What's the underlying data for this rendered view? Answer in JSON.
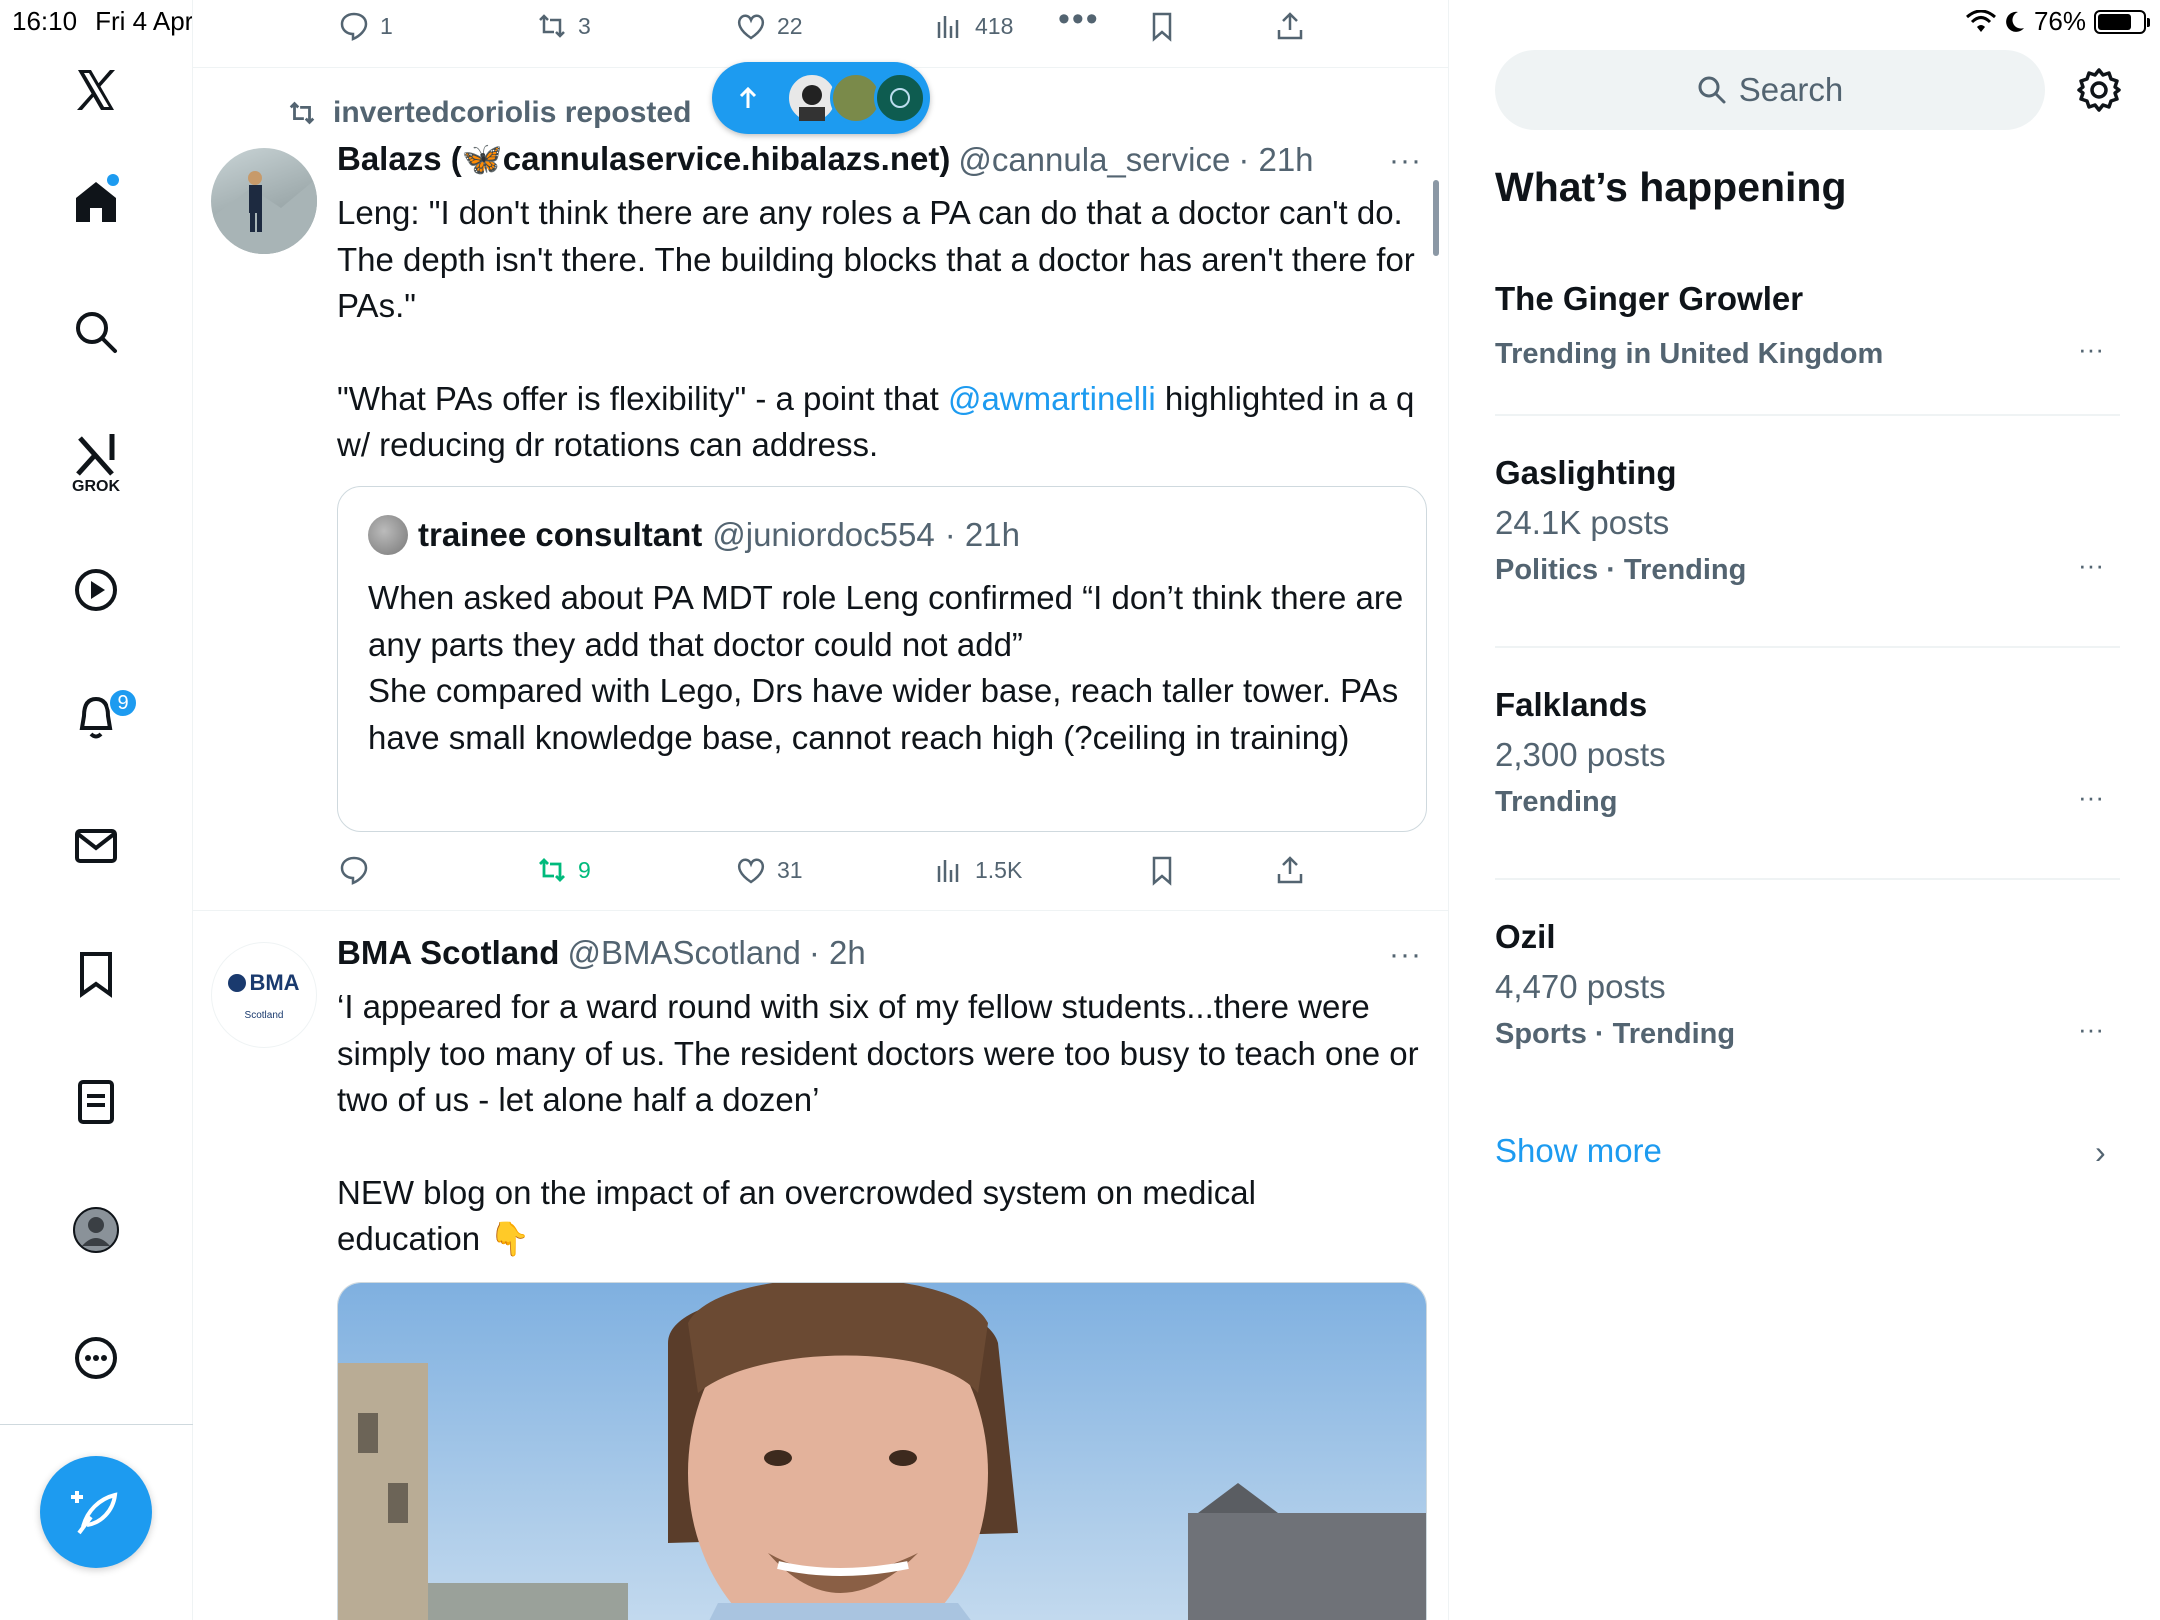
{
  "status_bar": {
    "time": "16:10",
    "date": "Fri 4 Apr",
    "battery": "76%",
    "battery_level": 0.76
  },
  "nav": {
    "grok_label": "GROK",
    "notifications_count": "9"
  },
  "top_post_actions": {
    "replies": "1",
    "reposts": "3",
    "likes": "22",
    "views": "418"
  },
  "new_posts_pill": {
    "icon": "arrow-up-icon"
  },
  "post1": {
    "repost_by": "invertedcoriolis reposted",
    "name": "Balazs (🦋cannulaservice.hibalazs.net)",
    "handle": "@cannula_service",
    "time": "· 21h",
    "more": "···",
    "text_1": "Leng: \"I don't think there are any roles a PA can do that a doctor can't do. The depth isn't there. The building blocks that a doctor has aren't there for PAs.\"",
    "text_2a": "\"What PAs offer is flexibility\" - a point that ",
    "mention": "@awmartinelli",
    "text_2b": " highlighted in a q w/ reducing dr rotations can address.",
    "quote": {
      "name": "trainee consultant",
      "handle": "@juniordoc554",
      "time": "· 21h",
      "text": "When asked about PA MDT role Leng confirmed “I don’t think there are any parts they add that doctor could not add”\nShe compared with Lego, Drs have wider base, reach taller tower. PAs have small knowledge base, cannot reach high (?ceiling in training)"
    },
    "actions": {
      "replies": "",
      "reposts": "9",
      "likes": "31",
      "views": "1.5K"
    }
  },
  "post2": {
    "avatar_text": "BMA",
    "avatar_sub": "Scotland",
    "name": "BMA Scotland",
    "handle": "@BMAScotland",
    "time": "· 2h",
    "more": "···",
    "text_1": "‘I appeared for a ward round with six of my fellow students...there were simply too many of us. The resident doctors were too busy to teach one or two of us - let alone half a dozen’",
    "text_2": "NEW blog on the impact of an overcrowded system on medical education 👇"
  },
  "sidebar": {
    "search_placeholder": "Search",
    "title": "What’s happening",
    "trends": [
      {
        "name": "The Ginger Growler",
        "posts": "",
        "category": "Trending in United Kingdom"
      },
      {
        "name": "Gaslighting",
        "posts": "24.1K posts",
        "category": "Politics · Trending"
      },
      {
        "name": "Falklands",
        "posts": "2,300 posts",
        "category": "Trending"
      },
      {
        "name": "Ozil",
        "posts": "4,470 posts",
        "category": "Sports · Trending"
      }
    ],
    "trend_more": "···",
    "show_more": "Show more"
  },
  "colors": {
    "accent": "#1d9bf0",
    "repost_green": "#00ba7c",
    "muted": "#536471"
  }
}
